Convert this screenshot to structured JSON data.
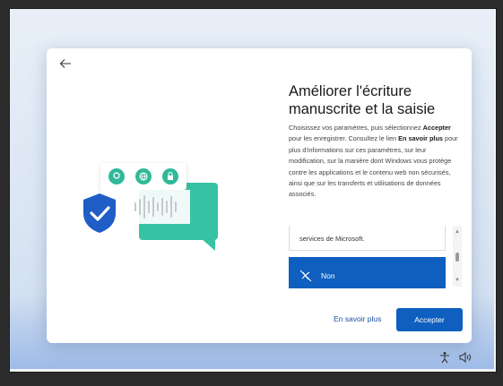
{
  "dialog": {
    "title": "Améliorer l'écriture manuscrite et la saisie",
    "desc": {
      "p1": "Choisissez vos paramètres, puis sélectionnez ",
      "accept_word": "Accepter",
      "p2": " pour les enregistrer. Consultez le lien ",
      "learn_words": "En savoir plus",
      "p3": " pour plus d'informations sur ces paramètres, sur leur modification, sur la manière dont Windows vous protège contre les applications et le contenu web non sécurisés, ainsi que sur les transferts et utilisations de données associés."
    },
    "options": {
      "previous_text": "services de Microsoft.",
      "no_label": "Non",
      "scroll_up_icon": "chevron-up-icon",
      "scroll_down_icon": "chevron-down-icon"
    },
    "learn_more_label": "En savoir plus",
    "accept_label": "Accepter"
  },
  "colors": {
    "accent": "#0e5fbf",
    "teal": "#36c3a3",
    "shield": "#1f5dc7"
  },
  "icons": {
    "back": "back-arrow-icon",
    "card": [
      "location-pin-icon",
      "globe-icon",
      "lock-icon"
    ],
    "tray": [
      "accessibility-icon",
      "volume-icon"
    ]
  }
}
